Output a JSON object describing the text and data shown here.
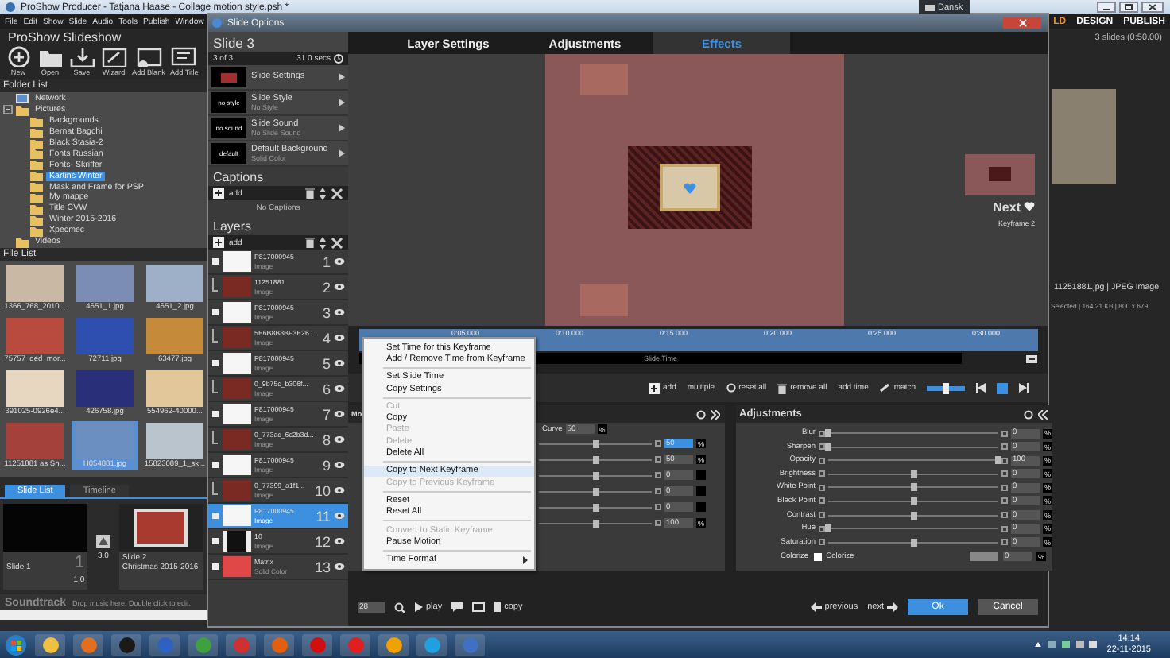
{
  "app": {
    "title": "ProShow Producer - Tatjana Haase - Collage motion style.psh *",
    "menu": [
      "File",
      "Edit",
      "Show",
      "Slide",
      "Audio",
      "Tools",
      "Publish",
      "Window"
    ],
    "modes": [
      {
        "label": "LD",
        "selected": true
      },
      {
        "label": "DESIGN",
        "selected": false
      },
      {
        "label": "PUBLISH",
        "selected": false
      }
    ],
    "heading": "ProShow Slideshow",
    "show_info": "3 slides (0:50.00)",
    "toolbar": [
      "New",
      "Open",
      "Save",
      "Wizard",
      "Add Blank",
      "Add Title"
    ]
  },
  "language_bar": "Dansk",
  "folder_list": {
    "title": "Folder List",
    "tree": [
      {
        "label": "Network",
        "kind": "network",
        "selected": false
      },
      {
        "label": "Pictures",
        "kind": "folder",
        "selected": false,
        "children": [
          {
            "label": "Backgrounds",
            "kind": "folder",
            "selected": false
          },
          {
            "label": "Bernat Bagchi",
            "kind": "folder",
            "selected": false
          },
          {
            "label": "Black Stasia-2",
            "kind": "folder",
            "selected": false
          },
          {
            "label": "Fonts Russian",
            "kind": "folder",
            "selected": false
          },
          {
            "label": "Fonts- Skriffer",
            "kind": "folder",
            "selected": false
          },
          {
            "label": "Kartins Winter",
            "kind": "folder",
            "selected": true
          },
          {
            "label": "Mask and Frame for PSP",
            "kind": "folder",
            "selected": false
          },
          {
            "label": "My mappe",
            "kind": "folder",
            "selected": false
          },
          {
            "label": "Title CVW",
            "kind": "folder",
            "selected": false
          },
          {
            "label": "Winter 2015-2016",
            "kind": "folder",
            "selected": false
          },
          {
            "label": "Xpecmec",
            "kind": "folder",
            "selected": false
          }
        ]
      },
      {
        "label": "Videos",
        "kind": "folder",
        "selected": false
      }
    ]
  },
  "file_list": {
    "title": "File List",
    "files": [
      {
        "name": "1366_768_2010...",
        "selected": false
      },
      {
        "name": "4651_1.jpg",
        "selected": false
      },
      {
        "name": "4651_2.jpg",
        "selected": false
      },
      {
        "name": "75757_ded_mor...",
        "selected": false
      },
      {
        "name": "72711.jpg",
        "selected": false
      },
      {
        "name": "63477.jpg",
        "selected": false
      },
      {
        "name": "391025-0926e4...",
        "selected": false
      },
      {
        "name": "426758.jpg",
        "selected": false
      },
      {
        "name": "554962-40000...",
        "selected": false
      },
      {
        "name": "11251881 as Sn...",
        "selected": false
      },
      {
        "name": "H054881.jpg",
        "selected": true
      },
      {
        "name": "15823089_1_sk...",
        "selected": false
      }
    ]
  },
  "slide_list": {
    "tabs": [
      {
        "label": "Slide List",
        "selected": true
      },
      {
        "label": "Timeline",
        "selected": false
      }
    ],
    "slides": [
      {
        "name": "Slide 1",
        "number": "1",
        "duration": "1.0"
      },
      {
        "name": "Slide 2",
        "subtitle": "Christmas 2015-2016"
      }
    ],
    "transition": "3.0",
    "soundtrack": "Soundtrack",
    "soundtrack_hint": "Drop music here. Double click to edit."
  },
  "file_info": {
    "name": "11251881.jpg | JPEG Image",
    "details": "Selected | 164.21 KB | 800 x 679"
  },
  "dialog": {
    "title": "Slide Options",
    "slide": "Slide 3",
    "position": "3 of 3",
    "duration": "31.0 secs",
    "options": [
      {
        "title": "Slide Settings",
        "kind": "image"
      },
      {
        "title": "Slide Style",
        "subtitle": "No Style",
        "kind": "text",
        "thumb": "no style"
      },
      {
        "title": "Slide Sound",
        "subtitle": "No Slide Sound",
        "kind": "text",
        "thumb": "no sound"
      },
      {
        "title": "Default Background",
        "subtitle": "Solid Color",
        "kind": "text",
        "thumb": "default"
      }
    ],
    "captions": {
      "title": "Captions",
      "add": "add",
      "empty": "No Captions"
    },
    "layers": {
      "title": "Layers",
      "add": "add",
      "items": [
        {
          "name": "P817000945",
          "type": "Image",
          "number": "1",
          "kind": "blank",
          "selected": false
        },
        {
          "name": "11251881",
          "type": "Image",
          "number": "2",
          "kind": "photo",
          "selected": false
        },
        {
          "name": "P817000945",
          "type": "Image",
          "number": "3",
          "kind": "blank",
          "selected": false
        },
        {
          "name": "5E6B8B8BF3E26...",
          "type": "Image",
          "number": "4",
          "kind": "photo",
          "selected": false
        },
        {
          "name": "P817000945",
          "type": "Image",
          "number": "5",
          "kind": "blank",
          "selected": false
        },
        {
          "name": "0_9b75c_b306f...",
          "type": "Image",
          "number": "6",
          "kind": "photo",
          "selected": false
        },
        {
          "name": "P817000945",
          "type": "Image",
          "number": "7",
          "kind": "blank",
          "selected": false
        },
        {
          "name": "0_773ac_6c2b3d...",
          "type": "Image",
          "number": "8",
          "kind": "photo",
          "selected": false
        },
        {
          "name": "P817000945",
          "type": "Image",
          "number": "9",
          "kind": "blank",
          "selected": false
        },
        {
          "name": "0_77399_a1f1...",
          "type": "Image",
          "number": "10",
          "kind": "photo",
          "selected": false
        },
        {
          "name": "P817000945",
          "type": "Image",
          "number": "11",
          "kind": "blank",
          "selected": true
        },
        {
          "name": "10",
          "type": "Image",
          "number": "12",
          "kind": "dark",
          "selected": false
        },
        {
          "name": "Matrix",
          "type": "Solid Color",
          "number": "13",
          "kind": "solid",
          "selected": false
        }
      ]
    },
    "tabs": [
      {
        "label": "Layer Settings",
        "selected": false
      },
      {
        "label": "Adjustments",
        "selected": false
      },
      {
        "label": "Effects",
        "selected": true
      }
    ],
    "preview": {
      "next": "Next",
      "next_keyframe": "Keyframe 2"
    },
    "timeline": {
      "ticks": [
        "0:05.000",
        "0:10.000",
        "0:15.000",
        "0:20.000",
        "0:25.000",
        "0:30.000"
      ],
      "label": "Slide Time"
    },
    "tools": [
      "add",
      "multiple",
      "reset all",
      "remove all",
      "add time",
      "match"
    ],
    "zoom_slider": {
      "level": 0.5
    },
    "motion": {
      "title": "Mo",
      "curve_label": "Curve",
      "curve": "50",
      "curve_unit": "%",
      "rows": [
        {
          "value": "50",
          "unit": "%",
          "level": 0.5,
          "selected": true
        },
        {
          "value": "50",
          "unit": "%",
          "level": 0.5,
          "selected": false
        },
        {
          "value": "0",
          "level": 0.5,
          "selected": false
        },
        {
          "value": "0",
          "level": 0.5,
          "selected": false
        },
        {
          "value": "0",
          "level": 0.5,
          "selected": false
        },
        {
          "value": "100",
          "unit": "%",
          "level": 0.5,
          "selected": false
        }
      ]
    },
    "adjustments": {
      "title": "Adjustments",
      "rows": [
        {
          "label": "Blur",
          "value": "0",
          "unit": "%",
          "level": 0
        },
        {
          "label": "Sharpen",
          "value": "0",
          "unit": "%",
          "level": 0
        },
        {
          "label": "Opacity",
          "value": "100",
          "unit": "%",
          "level": 1
        },
        {
          "label": "Brightness",
          "value": "0",
          "unit": "%",
          "level": 0.5
        },
        {
          "label": "White Point",
          "value": "0",
          "unit": "%",
          "level": 0.5
        },
        {
          "label": "Black Point",
          "value": "0",
          "unit": "%",
          "level": 0.5
        },
        {
          "label": "Contrast",
          "value": "0",
          "unit": "%",
          "level": 0.5
        },
        {
          "label": "Hue",
          "value": "0",
          "unit": "%",
          "level": 0
        },
        {
          "label": "Saturation",
          "value": "0",
          "unit": "%",
          "level": 0.5
        }
      ],
      "colorize_label": "Colorize",
      "colorize": {
        "label": "Colorize",
        "checked": false
      },
      "colorize_value": "0",
      "colorize_unit": "%"
    },
    "zoom": "28",
    "play": "play",
    "copy": "copy",
    "previous": "previous",
    "next": "next",
    "ok": "Ok",
    "cancel": "Cancel"
  },
  "context_menu": [
    {
      "kind": "item",
      "label": "Set Time for this Keyframe",
      "disabled": false,
      "selected": false
    },
    {
      "kind": "item",
      "label": "Add / Remove Time from Keyframe",
      "disabled": false,
      "selected": false
    },
    {
      "kind": "separator"
    },
    {
      "kind": "item",
      "label": "Set Slide Time",
      "disabled": false,
      "selected": false
    },
    {
      "kind": "item",
      "label": "Copy Settings",
      "disabled": false,
      "selected": false
    },
    {
      "kind": "separator"
    },
    {
      "kind": "item",
      "label": "Cut",
      "disabled": true,
      "selected": false
    },
    {
      "kind": "item",
      "label": "Copy",
      "disabled": false,
      "selected": false
    },
    {
      "kind": "item",
      "label": "Paste",
      "disabled": true,
      "selected": false
    },
    {
      "kind": "item",
      "label": "Delete",
      "disabled": true,
      "selected": false
    },
    {
      "kind": "item",
      "label": "Delete All",
      "disabled": false,
      "selected": false
    },
    {
      "kind": "separator"
    },
    {
      "kind": "item",
      "label": "Copy to Next Keyframe",
      "disabled": false,
      "selected": true
    },
    {
      "kind": "item",
      "label": "Copy to Previous Keyframe",
      "disabled": true,
      "selected": false
    },
    {
      "kind": "separator"
    },
    {
      "kind": "item",
      "label": "Reset",
      "disabled": false,
      "selected": false
    },
    {
      "kind": "item",
      "label": "Reset All",
      "disabled": false,
      "selected": false
    },
    {
      "kind": "separator"
    },
    {
      "kind": "item",
      "label": "Convert to Static Keyframe",
      "disabled": true,
      "selected": false
    },
    {
      "kind": "item",
      "label": "Pause Motion",
      "disabled": false,
      "selected": false
    },
    {
      "kind": "separator"
    },
    {
      "kind": "submenu",
      "label": "Time Format",
      "disabled": false,
      "selected": false
    }
  ],
  "taskbar": {
    "time": "14:14",
    "date": "22-11-2015"
  }
}
